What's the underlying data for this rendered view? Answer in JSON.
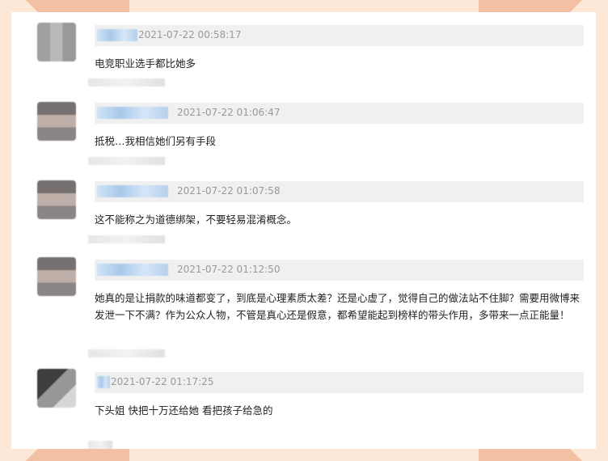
{
  "comments": [
    {
      "time": "2021-07-22 00:58:17",
      "text": "电竞职业选手都比她多"
    },
    {
      "time": "2021-07-22 01:06:47",
      "text": "抵税…我相信她们另有手段"
    },
    {
      "time": "2021-07-22 01:07:58",
      "text": "这不能称之为道德绑架，不要轻易混淆概念。"
    },
    {
      "time": "2021-07-22 01:12:50",
      "text": "她真的是让捐款的味道都变了，到底是心理素质太差？还是心虚了，觉得自己的做法站不住脚？需要用微博来发泄一下不满？作为公众人物，不管是真心还是假意，都希望能起到榜样的带头作用，多带来一点正能量！"
    },
    {
      "time": "2021-07-22 01:17:25",
      "text": "下头姐 快把十万还给她 看把孩子给急的"
    }
  ]
}
